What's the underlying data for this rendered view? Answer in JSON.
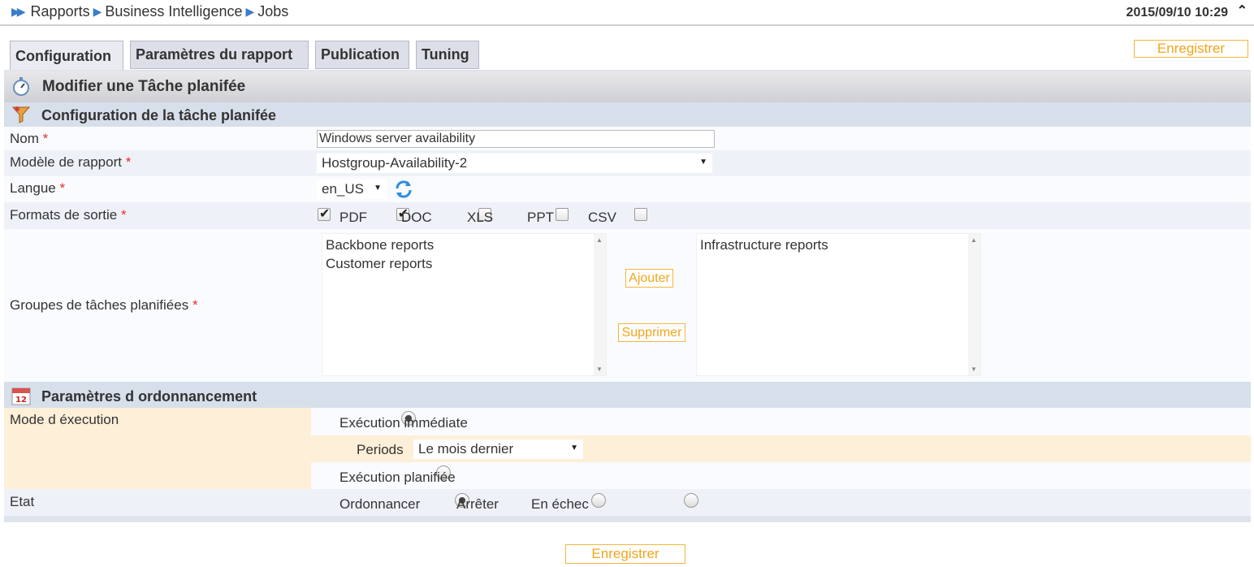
{
  "breadcrumb": {
    "items": [
      "Rapports",
      "Business Intelligence",
      "Jobs"
    ]
  },
  "header": {
    "datetime": "2015/09/10 10:29"
  },
  "tabs": [
    "Configuration",
    "Paramètres du rapport",
    "Publication",
    "Tuning"
  ],
  "buttons": {
    "save": "Enregistrer",
    "add": "Ajouter",
    "remove": "Supprimer"
  },
  "page_title": "Modifier une Tâche planifée",
  "section_config": {
    "title": "Configuration de la tâche planifée",
    "name_label": "Nom",
    "name_value": "Windows server availability",
    "model_label": "Modèle de rapport",
    "model_value": "Hostgroup-Availability-2",
    "lang_label": "Langue",
    "lang_value": "en_US",
    "formats_label": "Formats de sortie",
    "formats": [
      {
        "label": "PDF",
        "checked": true
      },
      {
        "label": "DOC",
        "checked": true
      },
      {
        "label": "XLS",
        "checked": false
      },
      {
        "label": "PPT",
        "checked": false
      },
      {
        "label": "CSV",
        "checked": false
      }
    ],
    "groups_label": "Groupes de tâches planifiées",
    "available_groups": [
      "Backbone reports",
      "Customer reports"
    ],
    "selected_groups": [
      "Infrastructure reports"
    ]
  },
  "section_schedule": {
    "title": "Paramètres d ordonnancement",
    "mode_label": "Mode d éxecution",
    "immediate_label": "Exécution immédiate",
    "periods_label": "Periods",
    "periods_value": "Le mois dernier",
    "planned_label": "Exécution planifiée",
    "state_label": "Etat",
    "states": [
      "Ordonnancer",
      "Arrêter",
      "En échec"
    ]
  },
  "colors": {
    "accent_orange": "#f2a51a",
    "highlight_row": "#fdefd8",
    "section_bg": "#d7dfea"
  }
}
